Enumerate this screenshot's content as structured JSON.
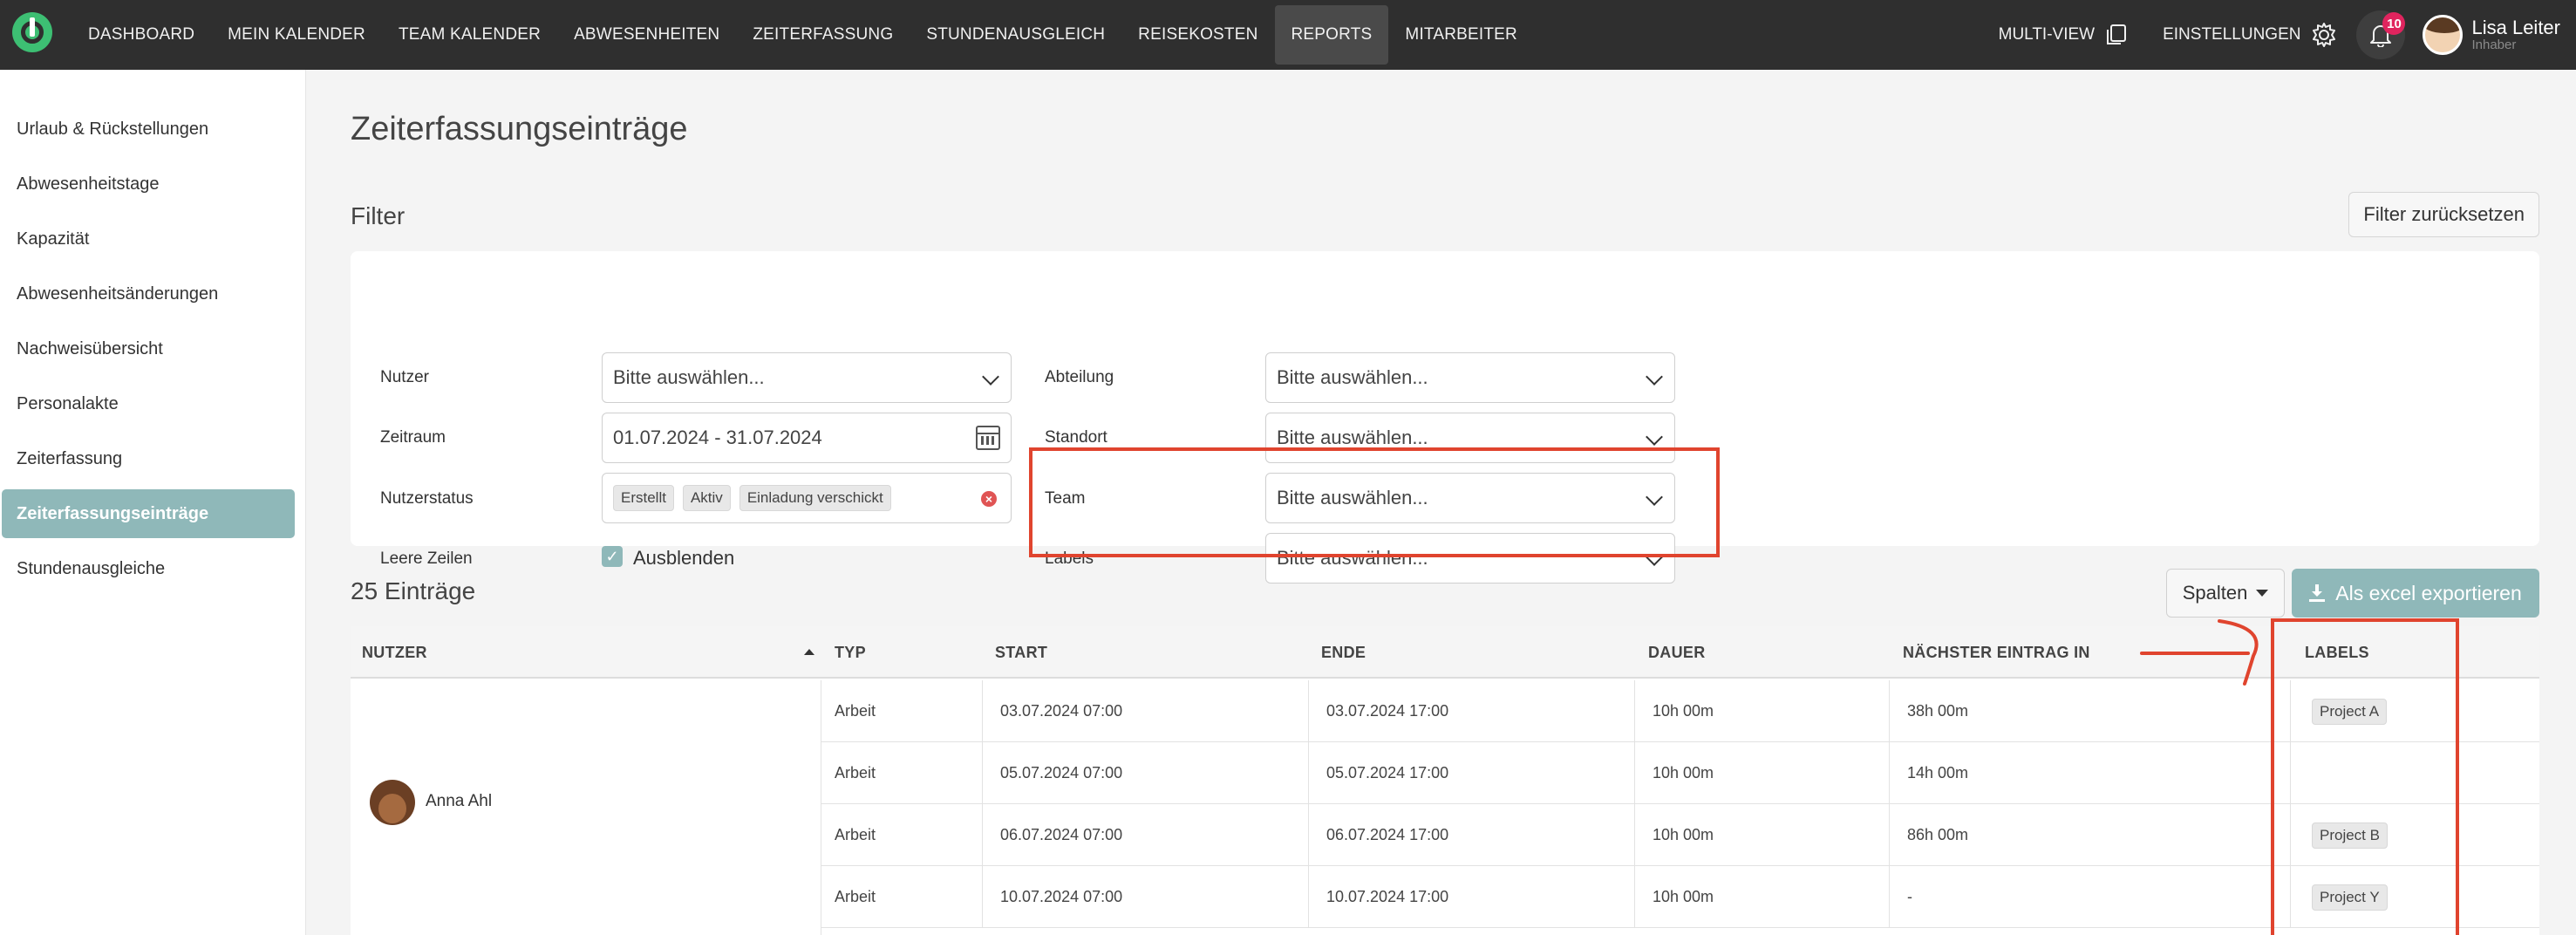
{
  "nav": {
    "items": [
      "DASHBOARD",
      "MEIN KALENDER",
      "TEAM KALENDER",
      "ABWESENHEITEN",
      "ZEITERFASSUNG",
      "STUNDENAUSGLEICH",
      "REISEKOSTEN",
      "REPORTS",
      "MITARBEITER"
    ],
    "active": "REPORTS",
    "multiview": "MULTI-VIEW",
    "settings": "EINSTELLUNGEN",
    "notifications": "10",
    "user_name": "Lisa Leiter",
    "user_role": "Inhaber"
  },
  "sidebar": {
    "items": [
      {
        "label": "Urlaub & Rückstellungen"
      },
      {
        "label": "Abwesenheitstage"
      },
      {
        "label": "Kapazität"
      },
      {
        "label": "Abwesenheitsänderungen"
      },
      {
        "label": "Nachweisübersicht"
      },
      {
        "label": "Personalakte"
      },
      {
        "label": "Zeiterfassung"
      },
      {
        "label": "Zeiterfassungseinträge"
      },
      {
        "label": "Stundenausgleiche"
      }
    ],
    "active": "Zeiterfassungseinträge"
  },
  "main": {
    "title": "Zeiterfassungseinträge",
    "filter_heading": "Filter",
    "reset_button": "Filter zurücksetzen"
  },
  "filters": {
    "nutzer": {
      "label": "Nutzer",
      "value": "Bitte auswählen..."
    },
    "zeitraum": {
      "label": "Zeitraum",
      "value": "01.07.2024 - 31.07.2024"
    },
    "nutzerstatus": {
      "label": "Nutzerstatus",
      "chips": [
        "Erstellt",
        "Aktiv",
        "Einladung verschickt"
      ]
    },
    "leere_zeilen": {
      "label": "Leere Zeilen",
      "value": "Ausblenden"
    },
    "abteilung": {
      "label": "Abteilung",
      "value": "Bitte auswählen..."
    },
    "standort": {
      "label": "Standort",
      "value": "Bitte auswählen..."
    },
    "team": {
      "label": "Team",
      "value": "Bitte auswählen..."
    },
    "labels": {
      "label": "Labels",
      "value": "Bitte auswählen..."
    }
  },
  "table": {
    "count": "25 Einträge",
    "columns_button": "Spalten",
    "export_button": "Als excel exportieren",
    "headers": [
      "NUTZER",
      "TYP",
      "START",
      "ENDE",
      "DAUER",
      "NÄCHSTER EINTRAG IN",
      "LABELS"
    ],
    "user": "Anna Ahl",
    "rows": [
      {
        "typ": "Arbeit",
        "start": "03.07.2024 07:00",
        "ende": "03.07.2024 17:00",
        "dauer": "10h 00m",
        "next": "38h 00m",
        "label": "Project A"
      },
      {
        "typ": "Arbeit",
        "start": "05.07.2024 07:00",
        "ende": "05.07.2024 17:00",
        "dauer": "10h 00m",
        "next": "14h 00m",
        "label": ""
      },
      {
        "typ": "Arbeit",
        "start": "06.07.2024 07:00",
        "ende": "06.07.2024 17:00",
        "dauer": "10h 00m",
        "next": "86h 00m",
        "label": "Project B"
      },
      {
        "typ": "Arbeit",
        "start": "10.07.2024 07:00",
        "ende": "10.07.2024 17:00",
        "dauer": "10h 00m",
        "next": "-",
        "label": "Project Y"
      }
    ]
  },
  "colors": {
    "topbar": "#2f2f2f",
    "accent": "#8fb8b9",
    "logo": "#3dbf73",
    "annotation": "#e0442e",
    "badge": "#e0245e"
  }
}
